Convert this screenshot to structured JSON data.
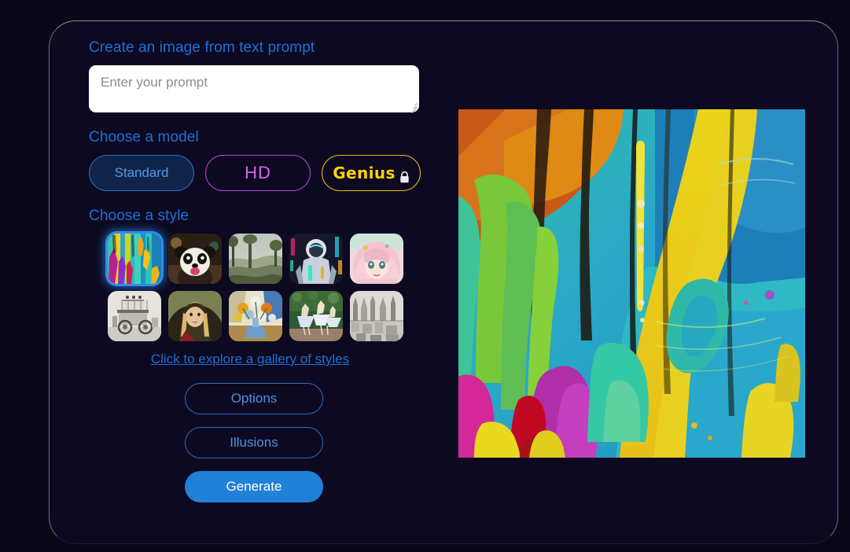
{
  "app": {
    "background_color": "#0a0718",
    "card_background_color": "#0c0920",
    "accent_color": "#1e70d8"
  },
  "prompt_section": {
    "title": "Create an image from text prompt",
    "input_value": "",
    "input_placeholder": "Enter your prompt"
  },
  "model_section": {
    "title": "Choose a model",
    "options": [
      {
        "label": "Standard",
        "selected": true,
        "color": "#5a97e0"
      },
      {
        "label": "HD",
        "selected": false,
        "color": "#d862f0"
      },
      {
        "label": "Genius",
        "selected": false,
        "color": "#ffd400",
        "locked": true,
        "lock_icon": "lock-icon"
      }
    ]
  },
  "style_section": {
    "title": "Choose a style",
    "selected_index": 0,
    "thumbnails": [
      {
        "name": "abstract-pour-painting",
        "selected": true
      },
      {
        "name": "panda-photoreal",
        "selected": false
      },
      {
        "name": "landscape-classical",
        "selected": false
      },
      {
        "name": "cyberpunk-robot",
        "selected": false
      },
      {
        "name": "anime-portrait",
        "selected": false
      },
      {
        "name": "vintage-car-sketch",
        "selected": false
      },
      {
        "name": "renaissance-portrait",
        "selected": false
      },
      {
        "name": "cubist-floral-still-life",
        "selected": false
      },
      {
        "name": "impressionist-ballerinas",
        "selected": false
      },
      {
        "name": "pen-ink-cityscape",
        "selected": false
      }
    ],
    "gallery_link": "Click to explore a gallery of styles"
  },
  "actions": {
    "options_label": "Options",
    "illusions_label": "Illusions",
    "generate_label": "Generate"
  },
  "result": {
    "name": "generated-artwork",
    "description": "Abstract fluid-pour painting in teal, yellow, orange, magenta and green"
  }
}
